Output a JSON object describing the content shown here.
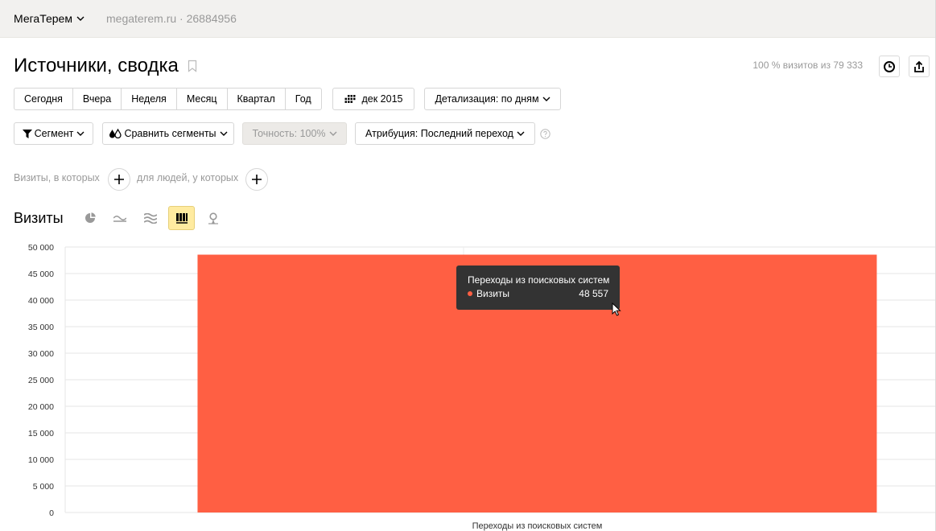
{
  "header": {
    "counter_name": "МегаТерем",
    "site": "megaterem.ru · 26884956"
  },
  "title": "Источники, сводка",
  "visits_share": "100 % визитов из 79 333",
  "periods": [
    {
      "label": "Сегодня"
    },
    {
      "label": "Вчера"
    },
    {
      "label": "Неделя"
    },
    {
      "label": "Месяц"
    },
    {
      "label": "Квартал"
    },
    {
      "label": "Год"
    }
  ],
  "date_button": "дек 2015",
  "detail_button": "Детализация: по дням",
  "segment_button": "Сегмент",
  "compare_button": "Сравнить сегменты",
  "accuracy_button": "Точность: 100%",
  "attribution_button": "Атрибуция: Последний переход",
  "filters": {
    "visits_label": "Визиты, в которых",
    "people_label": "для людей, у которых"
  },
  "section_title": "Визиты",
  "colors": {
    "bar": "#ff5f43",
    "active_chart_type": "#ffeba0"
  },
  "chart_data": {
    "type": "bar",
    "categories": [
      "Переходы из поисковых систем"
    ],
    "series": [
      {
        "name": "Визиты",
        "values": [
          48557
        ]
      }
    ],
    "ylim": [
      0,
      50000
    ],
    "yticks": [
      0,
      5000,
      10000,
      15000,
      20000,
      25000,
      30000,
      35000,
      40000,
      45000,
      50000
    ],
    "ytick_labels": [
      "0",
      "5 000",
      "10 000",
      "15 000",
      "20 000",
      "25 000",
      "30 000",
      "35 000",
      "40 000",
      "45 000",
      "50 000"
    ],
    "grid": true
  },
  "tooltip": {
    "title": "Переходы из поисковых систем",
    "series": "Визиты",
    "value": "48 557"
  }
}
